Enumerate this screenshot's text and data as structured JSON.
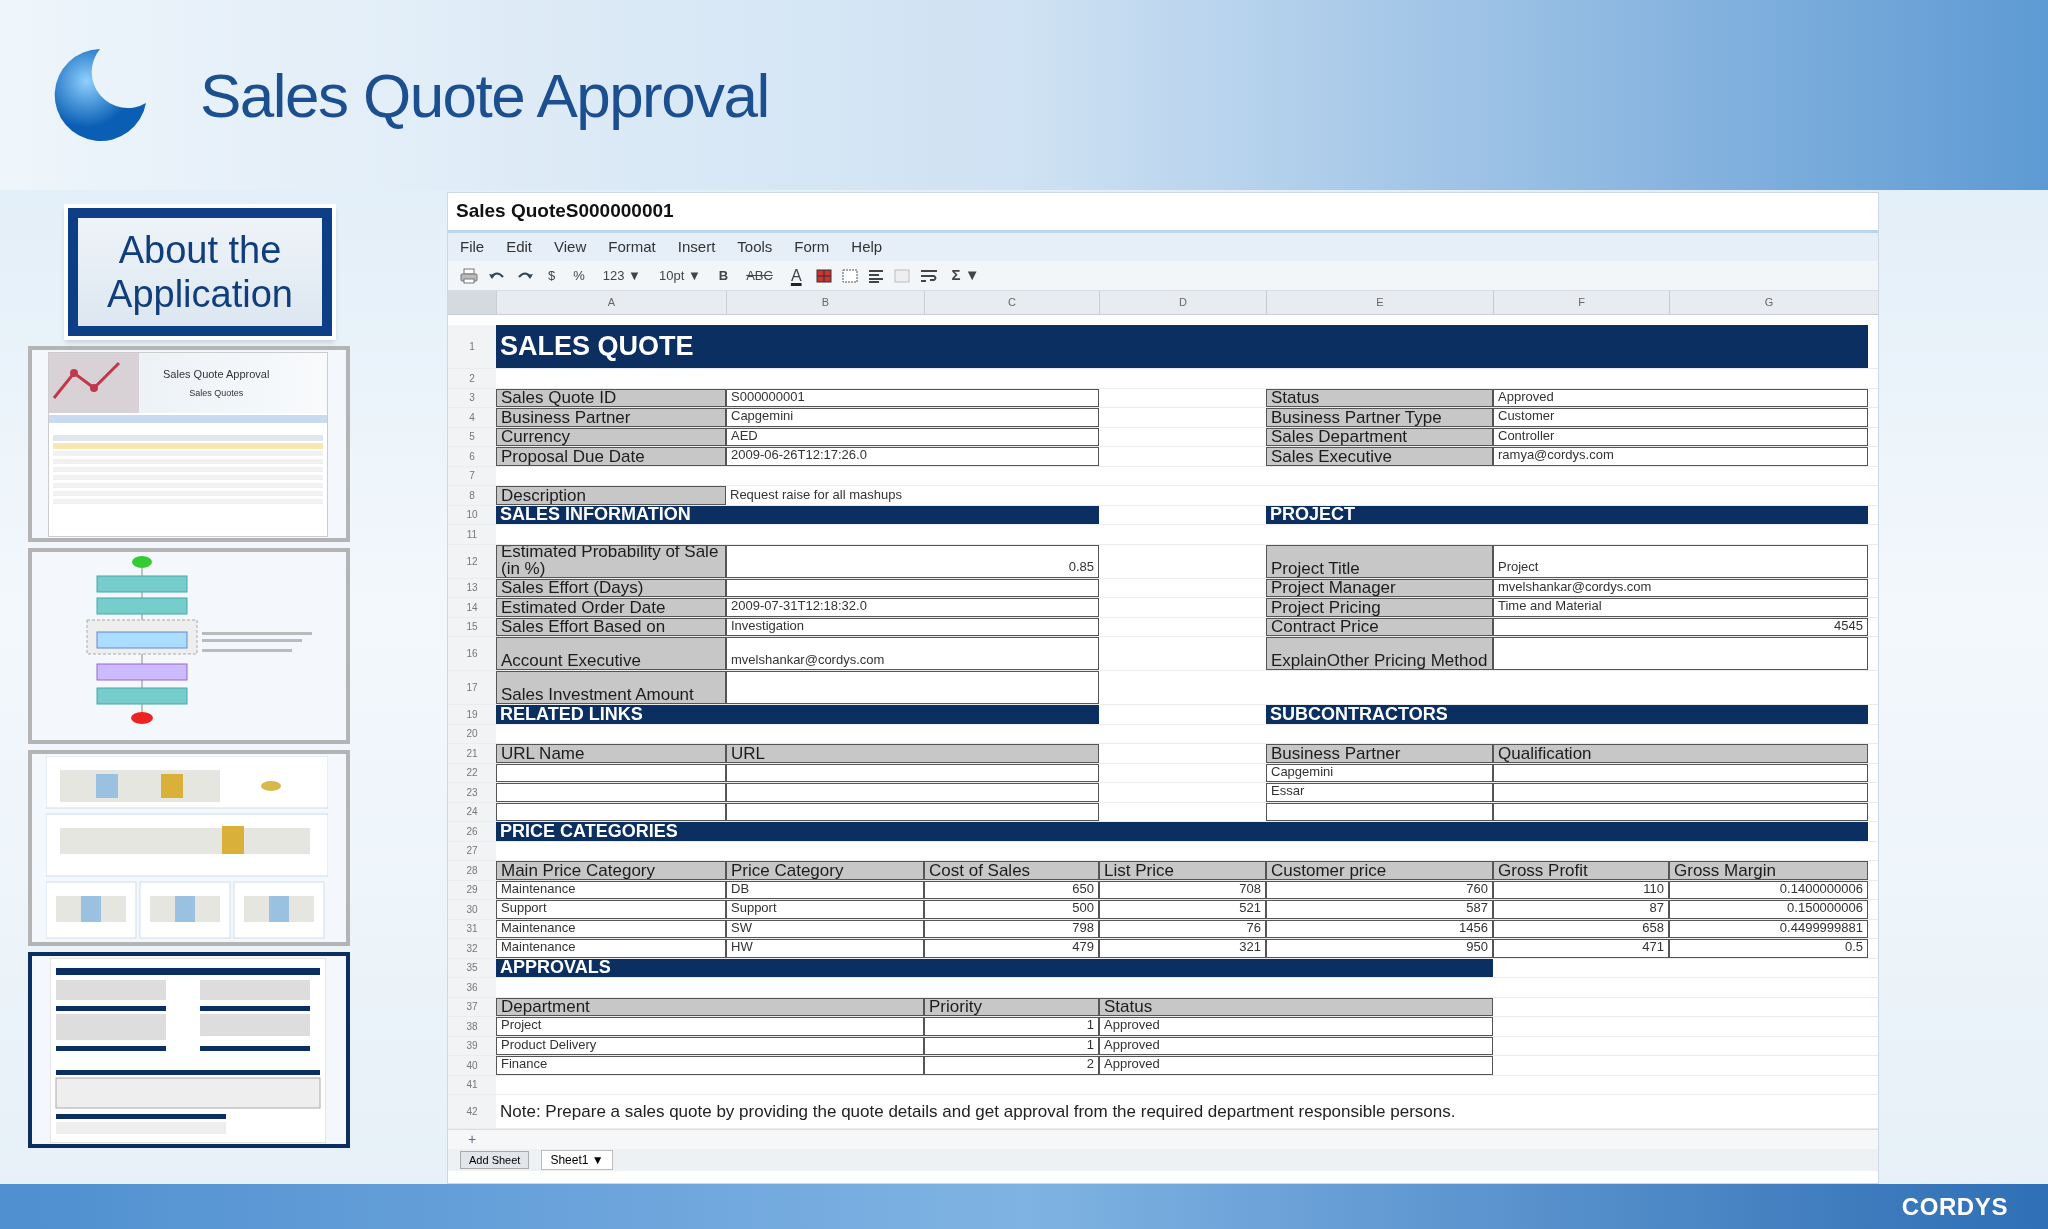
{
  "slide_title": "Sales Quote Approval",
  "sidebar": {
    "about_button": "About the Application",
    "thumbnails": [
      {
        "kind": "list",
        "title": "Sales Quote Approval",
        "subtitle": "Sales Quotes",
        "selected": false
      },
      {
        "kind": "flow",
        "selected": false
      },
      {
        "kind": "charts",
        "selected": false
      },
      {
        "kind": "sheet",
        "selected": true
      }
    ]
  },
  "sheet": {
    "title": "Sales QuoteS000000001",
    "menu": [
      "File",
      "Edit",
      "View",
      "Format",
      "Insert",
      "Tools",
      "Form",
      "Help"
    ],
    "toolbar": [
      {
        "kind": "print"
      },
      {
        "kind": "undo"
      },
      {
        "kind": "redo"
      },
      {
        "kind": "text",
        "label": "$"
      },
      {
        "kind": "text",
        "label": "%"
      },
      {
        "kind": "dropdown",
        "label": "123 ▼"
      },
      {
        "kind": "dropdown",
        "label": "10pt ▼"
      },
      {
        "kind": "bold",
        "label": "B"
      },
      {
        "kind": "strike",
        "label": "ABC"
      },
      {
        "kind": "color",
        "label": "A"
      },
      {
        "kind": "fill"
      },
      {
        "kind": "borders"
      },
      {
        "kind": "align"
      },
      {
        "kind": "merge"
      },
      {
        "kind": "wrap"
      },
      {
        "kind": "sum",
        "label": "Σ ▼"
      }
    ],
    "columns": [
      "A",
      "B",
      "C",
      "D",
      "E",
      "F",
      "G"
    ],
    "rows": [
      {
        "number": "1",
        "kind": "title",
        "cells": [
          {
            "kind": "title",
            "text": "SALES QUOTE"
          },
          {
            "kind": "span"
          },
          {
            "kind": "span"
          },
          {
            "kind": "span"
          },
          {
            "kind": "span"
          },
          {
            "kind": "span"
          },
          {
            "kind": "span"
          }
        ]
      },
      {
        "number": "2",
        "kind": "normal",
        "cells": []
      },
      {
        "number": "3",
        "kind": "normal",
        "cells": [
          {
            "kind": "label",
            "text": "Sales Quote ID"
          },
          {
            "kind": "value",
            "text": "S000000001"
          },
          {
            "kind": "span"
          },
          {
            "kind": "blank"
          },
          {
            "kind": "label",
            "text": "Status"
          },
          {
            "kind": "value",
            "text": "Approved"
          },
          {
            "kind": "span"
          }
        ]
      },
      {
        "number": "4",
        "kind": "normal",
        "cells": [
          {
            "kind": "label",
            "text": "Business Partner"
          },
          {
            "kind": "value",
            "text": "Capgemini"
          },
          {
            "kind": "span"
          },
          {
            "kind": "blank"
          },
          {
            "kind": "label",
            "text": "Business Partner Type"
          },
          {
            "kind": "value",
            "text": "Customer"
          },
          {
            "kind": "span"
          }
        ]
      },
      {
        "number": "5",
        "kind": "normal",
        "cells": [
          {
            "kind": "label",
            "text": "Currency"
          },
          {
            "kind": "value",
            "text": "AED"
          },
          {
            "kind": "span"
          },
          {
            "kind": "blank"
          },
          {
            "kind": "label",
            "text": "Sales Department"
          },
          {
            "kind": "value",
            "text": "Controller"
          },
          {
            "kind": "span"
          }
        ]
      },
      {
        "number": "6",
        "kind": "normal",
        "cells": [
          {
            "kind": "label",
            "text": "Proposal Due Date"
          },
          {
            "kind": "value",
            "text": "2009-06-26T12:17:26.0"
          },
          {
            "kind": "span"
          },
          {
            "kind": "blank"
          },
          {
            "kind": "label",
            "text": "Sales Executive"
          },
          {
            "kind": "value",
            "text": "ramya@cordys.com"
          },
          {
            "kind": "span"
          }
        ]
      },
      {
        "number": "7",
        "kind": "normal",
        "cells": []
      },
      {
        "number": "8",
        "kind": "normal",
        "cells": [
          {
            "kind": "label",
            "text": "Description"
          },
          {
            "kind": "plain",
            "text": "Request raise for all mashups"
          },
          {
            "kind": "span"
          },
          {
            "kind": "span"
          }
        ]
      },
      {
        "number": "10",
        "kind": "normal",
        "cells": [
          {
            "kind": "heading",
            "text": "SALES INFORMATION"
          },
          {
            "kind": "span"
          },
          {
            "kind": "span"
          },
          {
            "kind": "blank"
          },
          {
            "kind": "heading",
            "text": "PROJECT"
          },
          {
            "kind": "span"
          },
          {
            "kind": "span"
          }
        ]
      },
      {
        "number": "11",
        "kind": "normal",
        "cells": []
      },
      {
        "number": "12",
        "kind": "tall",
        "cells": [
          {
            "kind": "label",
            "text": "Estimated Probability of Sale (in %)"
          },
          {
            "kind": "open",
            "text": ""
          },
          {
            "kind": "joined",
            "text": "0.85"
          },
          {
            "kind": "blank"
          },
          {
            "kind": "label",
            "text": "Project Title"
          },
          {
            "kind": "value",
            "text": "Project"
          },
          {
            "kind": "span"
          }
        ]
      },
      {
        "number": "13",
        "kind": "normal",
        "cells": [
          {
            "kind": "label",
            "text": "Sales Effort (Days)"
          },
          {
            "kind": "value",
            "text": ""
          },
          {
            "kind": "span"
          },
          {
            "kind": "blank"
          },
          {
            "kind": "label",
            "text": "Project Manager"
          },
          {
            "kind": "value",
            "text": "mvelshankar@cordys.com"
          },
          {
            "kind": "span"
          }
        ]
      },
      {
        "number": "14",
        "kind": "normal",
        "cells": [
          {
            "kind": "label",
            "text": "Estimated Order Date"
          },
          {
            "kind": "value",
            "text": "2009-07-31T12:18:32.0"
          },
          {
            "kind": "span"
          },
          {
            "kind": "blank"
          },
          {
            "kind": "label",
            "text": "Project Pricing"
          },
          {
            "kind": "value",
            "text": "Time and Material"
          },
          {
            "kind": "span"
          }
        ]
      },
      {
        "number": "15",
        "kind": "normal",
        "cells": [
          {
            "kind": "label",
            "text": "Sales Effort Based on"
          },
          {
            "kind": "value",
            "text": "Investigation"
          },
          {
            "kind": "span"
          },
          {
            "kind": "blank"
          },
          {
            "kind": "label",
            "text": "Contract Price"
          },
          {
            "kind": "open",
            "text": ""
          },
          {
            "kind": "joined",
            "text": "4545"
          }
        ]
      },
      {
        "number": "16",
        "kind": "tall",
        "cells": [
          {
            "kind": "label",
            "text": "Account Executive"
          },
          {
            "kind": "value",
            "text": "mvelshankar@cordys.com"
          },
          {
            "kind": "span"
          },
          {
            "kind": "blank"
          },
          {
            "kind": "label",
            "text": "ExplainOther Pricing Method"
          },
          {
            "kind": "value",
            "text": ""
          },
          {
            "kind": "span"
          }
        ]
      },
      {
        "number": "17",
        "kind": "tall",
        "cells": [
          {
            "kind": "label",
            "text": "Sales Investment Amount"
          },
          {
            "kind": "value",
            "text": ""
          },
          {
            "kind": "span"
          }
        ]
      },
      {
        "number": "19",
        "kind": "normal",
        "cells": [
          {
            "kind": "heading",
            "text": "RELATED LINKS"
          },
          {
            "kind": "span"
          },
          {
            "kind": "span"
          },
          {
            "kind": "blank"
          },
          {
            "kind": "heading",
            "text": "SUBCONTRACTORS"
          },
          {
            "kind": "span"
          },
          {
            "kind": "span"
          }
        ]
      },
      {
        "number": "20",
        "kind": "normal",
        "cells": []
      },
      {
        "number": "21",
        "kind": "normal",
        "cells": [
          {
            "kind": "colhead",
            "text": "URL Name"
          },
          {
            "kind": "colhead",
            "text": "URL"
          },
          {
            "kind": "span"
          },
          {
            "kind": "blank"
          },
          {
            "kind": "colhead",
            "text": "Business Partner"
          },
          {
            "kind": "colhead",
            "text": "Qualification"
          },
          {
            "kind": "span"
          }
        ]
      },
      {
        "number": "22",
        "kind": "normal",
        "cells": [
          {
            "kind": "value",
            "text": ""
          },
          {
            "kind": "value",
            "text": ""
          },
          {
            "kind": "span"
          },
          {
            "kind": "blank"
          },
          {
            "kind": "value",
            "text": "Capgemini"
          },
          {
            "kind": "value",
            "text": ""
          },
          {
            "kind": "span"
          }
        ]
      },
      {
        "number": "23",
        "kind": "normal",
        "cells": [
          {
            "kind": "value",
            "text": ""
          },
          {
            "kind": "value",
            "text": ""
          },
          {
            "kind": "span"
          },
          {
            "kind": "blank"
          },
          {
            "kind": "value",
            "text": "Essar"
          },
          {
            "kind": "value",
            "text": ""
          },
          {
            "kind": "span"
          }
        ]
      },
      {
        "number": "24",
        "kind": "normal",
        "cells": [
          {
            "kind": "value",
            "text": ""
          },
          {
            "kind": "value",
            "text": ""
          },
          {
            "kind": "span"
          },
          {
            "kind": "blank"
          },
          {
            "kind": "value",
            "text": ""
          },
          {
            "kind": "value",
            "text": ""
          },
          {
            "kind": "span"
          }
        ]
      },
      {
        "number": "26",
        "kind": "normal",
        "cells": [
          {
            "kind": "heading",
            "text": "PRICE CATEGORIES"
          },
          {
            "kind": "span"
          },
          {
            "kind": "span"
          },
          {
            "kind": "span"
          },
          {
            "kind": "span"
          },
          {
            "kind": "span"
          },
          {
            "kind": "span"
          }
        ]
      },
      {
        "number": "27",
        "kind": "normal",
        "cells": []
      },
      {
        "number": "28",
        "kind": "normal",
        "cells": [
          {
            "kind": "colhead",
            "text": "Main Price Category"
          },
          {
            "kind": "colhead",
            "text": "Price Category"
          },
          {
            "kind": "colhead",
            "text": "Cost of Sales"
          },
          {
            "kind": "colhead",
            "text": "List Price"
          },
          {
            "kind": "colhead",
            "text": "Customer price"
          },
          {
            "kind": "colhead",
            "text": "Gross Profit"
          },
          {
            "kind": "colhead",
            "text": "Gross Margin"
          }
        ]
      },
      {
        "number": "29",
        "kind": "normal",
        "cells": [
          {
            "kind": "value",
            "text": "Maintenance"
          },
          {
            "kind": "value",
            "text": "DB"
          },
          {
            "kind": "number",
            "text": "650"
          },
          {
            "kind": "number",
            "text": "708"
          },
          {
            "kind": "number",
            "text": "760"
          },
          {
            "kind": "number",
            "text": "110"
          },
          {
            "kind": "number",
            "text": "0.1400000006"
          }
        ]
      },
      {
        "number": "30",
        "kind": "normal",
        "cells": [
          {
            "kind": "value",
            "text": "Support"
          },
          {
            "kind": "value",
            "text": "Support"
          },
          {
            "kind": "number",
            "text": "500"
          },
          {
            "kind": "number",
            "text": "521"
          },
          {
            "kind": "number",
            "text": "587"
          },
          {
            "kind": "number",
            "text": "87"
          },
          {
            "kind": "number",
            "text": "0.150000006"
          }
        ]
      },
      {
        "number": "31",
        "kind": "normal",
        "cells": [
          {
            "kind": "value",
            "text": "Maintenance"
          },
          {
            "kind": "value",
            "text": "SW"
          },
          {
            "kind": "number",
            "text": "798"
          },
          {
            "kind": "number",
            "text": "76"
          },
          {
            "kind": "number",
            "text": "1456"
          },
          {
            "kind": "number",
            "text": "658"
          },
          {
            "kind": "number",
            "text": "0.4499999881"
          }
        ]
      },
      {
        "number": "32",
        "kind": "normal",
        "cells": [
          {
            "kind": "value",
            "text": "Maintenance"
          },
          {
            "kind": "value",
            "text": "HW"
          },
          {
            "kind": "number",
            "text": "479"
          },
          {
            "kind": "number",
            "text": "321"
          },
          {
            "kind": "number",
            "text": "950"
          },
          {
            "kind": "number",
            "text": "471"
          },
          {
            "kind": "number",
            "text": "0.5"
          }
        ]
      },
      {
        "number": "35",
        "kind": "normal",
        "cells": [
          {
            "kind": "heading",
            "text": "APPROVALS"
          },
          {
            "kind": "span"
          },
          {
            "kind": "span"
          },
          {
            "kind": "span"
          },
          {
            "kind": "span"
          }
        ]
      },
      {
        "number": "36",
        "kind": "normal",
        "cells": []
      },
      {
        "number": "37",
        "kind": "normal",
        "cells": [
          {
            "kind": "colhead",
            "text": "Department"
          },
          {
            "kind": "span"
          },
          {
            "kind": "colhead",
            "text": "Priority"
          },
          {
            "kind": "colhead",
            "text": "Status"
          },
          {
            "kind": "span"
          }
        ]
      },
      {
        "number": "38",
        "kind": "normal",
        "cells": [
          {
            "kind": "value",
            "text": "Project"
          },
          {
            "kind": "span"
          },
          {
            "kind": "number",
            "text": "1"
          },
          {
            "kind": "value",
            "text": "Approved"
          },
          {
            "kind": "span"
          }
        ]
      },
      {
        "number": "39",
        "kind": "normal",
        "cells": [
          {
            "kind": "value",
            "text": "Product Delivery"
          },
          {
            "kind": "span"
          },
          {
            "kind": "number",
            "text": "1"
          },
          {
            "kind": "value",
            "text": "Approved"
          },
          {
            "kind": "span"
          }
        ]
      },
      {
        "number": "40",
        "kind": "normal",
        "cells": [
          {
            "kind": "value",
            "text": "Finance"
          },
          {
            "kind": "span"
          },
          {
            "kind": "number",
            "text": "2"
          },
          {
            "kind": "value",
            "text": "Approved"
          },
          {
            "kind": "span"
          }
        ]
      },
      {
        "number": "41",
        "kind": "normal",
        "cells": []
      },
      {
        "number": "42",
        "kind": "tall",
        "cells": [
          {
            "kind": "note",
            "text": "Note: Prepare a sales quote by providing the quote details and get approval from the required department responsible persons."
          },
          {
            "kind": "span"
          },
          {
            "kind": "span"
          },
          {
            "kind": "span"
          },
          {
            "kind": "span"
          },
          {
            "kind": "span"
          },
          {
            "kind": "span"
          }
        ]
      }
    ],
    "add_row": "+",
    "sheet_tabs": [
      {
        "label": "Add Sheet",
        "kind": "button"
      },
      {
        "label": "Sheet1 ▼",
        "kind": "tab"
      }
    ]
  },
  "brand": "CORDYS"
}
